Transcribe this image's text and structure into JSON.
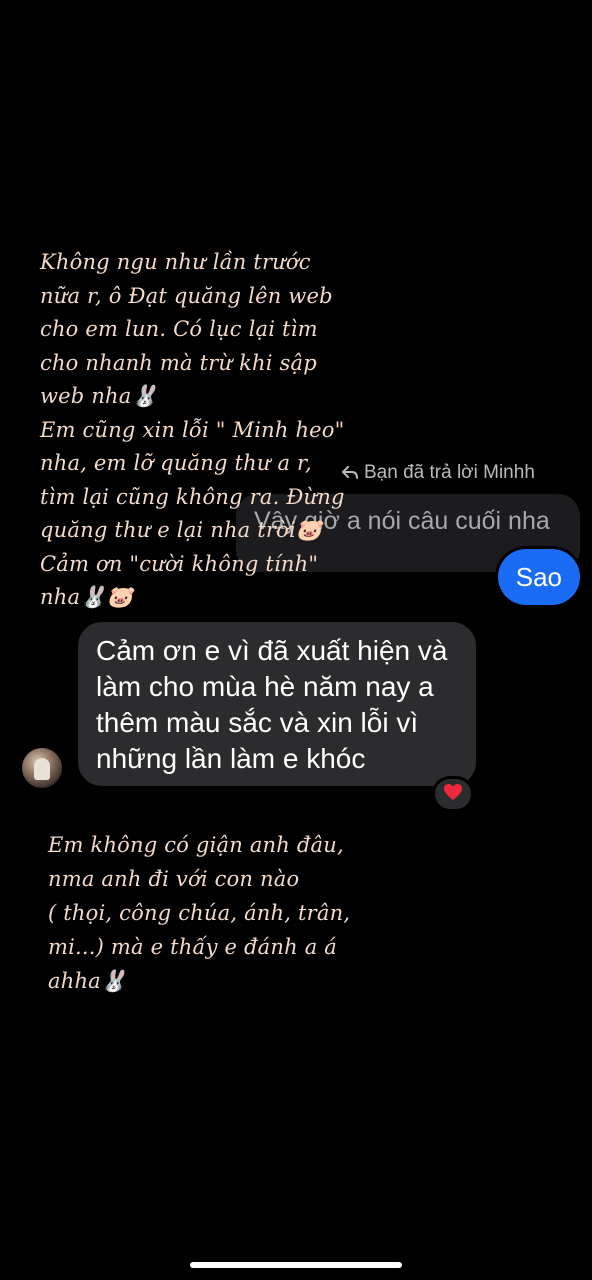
{
  "reply_header": {
    "text": "Bạn đã trả lời Minhh"
  },
  "quoted_message": {
    "text": "Vậy giờ a nói câu cuối nha"
  },
  "sent_message": {
    "text": "Sao"
  },
  "received_message": {
    "text": "Cảm ơn e vì đã xuất hiện và làm cho mùa hè năm nay a thêm màu sắc và xin lỗi vì những lần làm e khóc",
    "reaction": "❤️"
  },
  "handwritten_note_top": {
    "text": "Không ngu như lần trước\nnữa r, ô Đạt quăng lên web\ncho em lun. Có lục lại tìm\ncho nhanh mà trừ khi sập\nweb nha🐰\nEm cũng xin lỗi \" Minh heo\"\nnha, em lỡ quăng thư a r,\ntìm lại cũng không ra. Đừng\nquăng thư e lại nha trời🐷\nCảm ơn \"cười không tính\"\nnha🐰🐷"
  },
  "handwritten_note_bottom": {
    "text": "Em không có giận anh đâu,\nnma anh đi với con nào\n( thọi, công chúa, ánh, trân,\nmi...) mà e thấy e đánh a á\nahha🐰"
  },
  "colors": {
    "background": "#000000",
    "sent_bubble": "#1a6cf5",
    "received_bubble": "#2c2c2e",
    "quoted_bubble": "#1c1c1e",
    "handwriting": "#f3d9c7"
  },
  "icons": {
    "reply": "reply-arrow-icon",
    "reaction": "heart-icon"
  }
}
